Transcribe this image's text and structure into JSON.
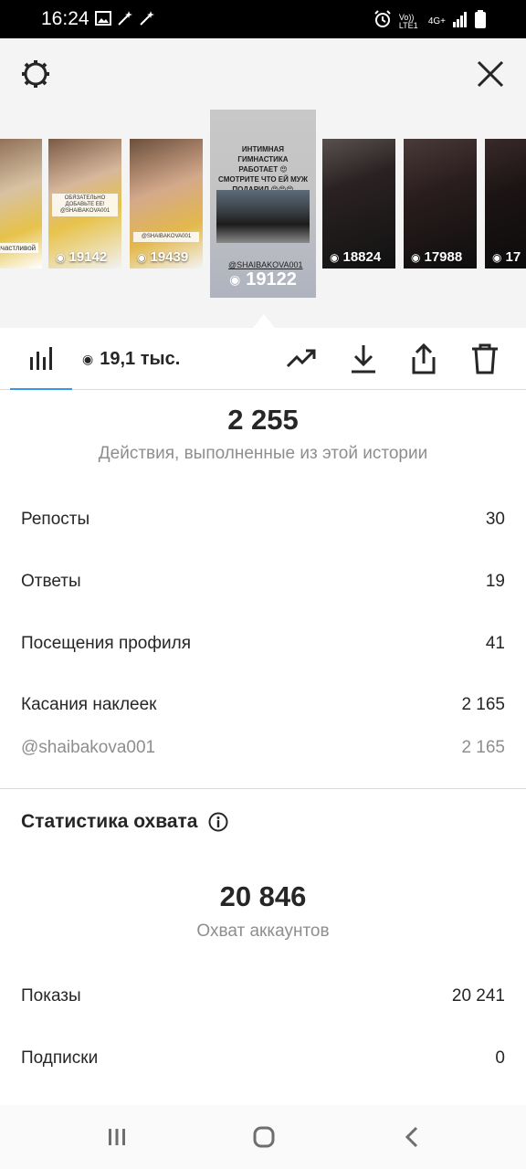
{
  "status_bar": {
    "time": "16:24",
    "network_label": "Vo)) LTE1",
    "network_type": "4G+"
  },
  "stories": {
    "thumbnails": [
      {
        "views": "",
        "caption": "счастливой"
      },
      {
        "views": "19142",
        "caption": "ОБЯЗАТЕЛЬНО ДОБАВЬТЕ ЕЕ! @SHAIBAKOVA001"
      },
      {
        "views": "19439",
        "caption": "@SHAIBAKOVA001"
      },
      {
        "views": "18824",
        "caption": ""
      },
      {
        "views": "17988",
        "caption": ""
      },
      {
        "views": "17",
        "caption": ""
      }
    ],
    "selected": {
      "text": "ИНТИМНАЯ ГИМНАСТИКА РАБОТАЕТ 😍 СМОТРИТЕ ЧТО ЕЙ МУЖ ПОДАРИЛ 😍😍😍",
      "handle": "@SHAIBAKOVA001",
      "views": "19122"
    }
  },
  "toolbar": {
    "views_label": "19,1 тыс."
  },
  "actions": {
    "total": "2 255",
    "subtitle": "Действия, выполненные из этой истории",
    "rows": [
      {
        "label": "Репосты",
        "value": "30"
      },
      {
        "label": "Ответы",
        "value": "19"
      },
      {
        "label": "Посещения профиля",
        "value": "41"
      },
      {
        "label": "Касания наклеек",
        "value": "2 165"
      }
    ],
    "sticker_detail": {
      "label": "@shaibakova001",
      "value": "2 165"
    }
  },
  "reach": {
    "title": "Статистика охвата",
    "total": "20 846",
    "subtitle": "Охват аккаунтов",
    "rows": [
      {
        "label": "Показы",
        "value": "20 241"
      },
      {
        "label": "Подписки",
        "value": "0"
      }
    ]
  },
  "colors": {
    "accent": "#3897f0",
    "text": "#262626",
    "muted": "#8e8e8e"
  }
}
